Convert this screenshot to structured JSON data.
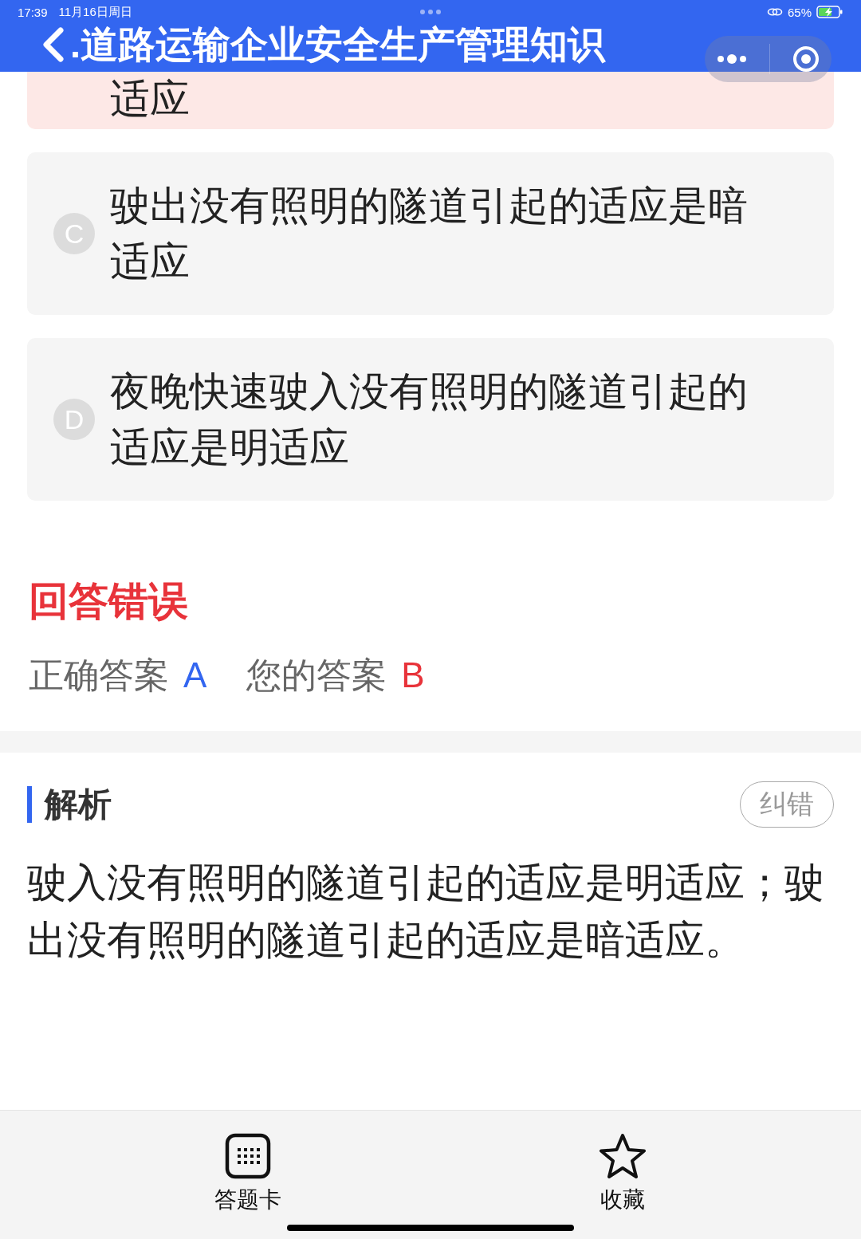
{
  "status_bar": {
    "time": "17:39",
    "date": "11月16日周日",
    "battery": "65%",
    "charging": true
  },
  "header": {
    "title": ".道路运输企业安全生产管理知识"
  },
  "options": [
    {
      "text": "适应",
      "selected": true
    },
    {
      "letter": "C",
      "text": "驶出没有照明的隧道引起的适应是暗适应",
      "selected": false
    },
    {
      "letter": "D",
      "text": "夜晚快速驶入没有照明的隧道引起的适应是明适应",
      "selected": false
    }
  ],
  "result": {
    "title": "回答错误",
    "correct_label": "正确答案",
    "correct_value": "A",
    "yours_label": "您的答案",
    "yours_value": "B"
  },
  "analysis": {
    "title": "解析",
    "report_button": "纠错",
    "text": "驶入没有照明的隧道引起的适应是明适应；驶出没有照明的隧道引起的适应是暗适应。"
  },
  "bottom_bar": [
    {
      "kind": "grid",
      "label": "答题卡"
    },
    {
      "kind": "star",
      "label": "收藏"
    }
  ]
}
